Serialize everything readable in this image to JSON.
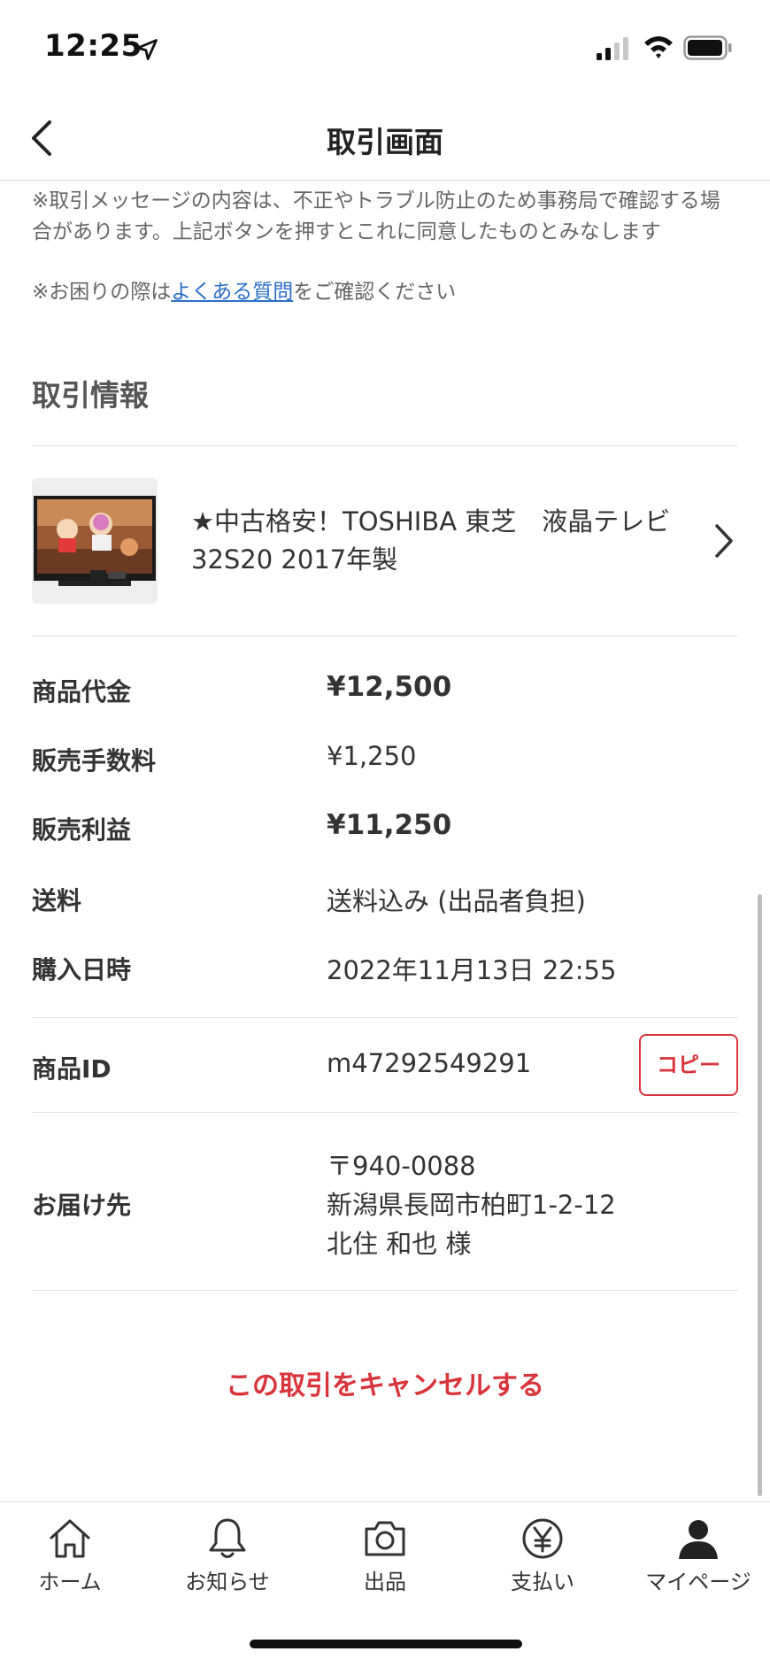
{
  "status_bar": {
    "time": "12:25"
  },
  "header": {
    "title": "取引画面"
  },
  "notices": {
    "line1": "※取引メッセージの内容は、不正やトラブル防止のため事務局で確認する場合があります。上記ボタンを押すとこれに同意したものとみなします",
    "line2_prefix": "※お困りの際は",
    "line2_link": "よくある質問",
    "line2_suffix": "をご確認ください"
  },
  "section_title": "取引情報",
  "product": {
    "name": "★中古格安！TOSHIBA 東芝　液晶テレビ 32S20 2017年製"
  },
  "details": {
    "price_label": "商品代金",
    "price_value": "¥12,500",
    "fee_label": "販売手数料",
    "fee_value": "¥1,250",
    "profit_label": "販売利益",
    "profit_value": "¥11,250",
    "shipping_label": "送料",
    "shipping_value": "送料込み (出品者負担)",
    "date_label": "購入日時",
    "date_value": "2022年11月13日 22:55",
    "id_label": "商品ID",
    "id_value": "m47292549291",
    "copy_label": "コピー",
    "address_label": "お届け先",
    "address_postal": "〒940-0088",
    "address_line": "新潟県長岡市柏町1-2-12",
    "address_name": "北住 和也 様"
  },
  "cancel_label": "この取引をキャンセルする",
  "tabs": [
    {
      "label": "ホーム",
      "icon": "home-icon"
    },
    {
      "label": "お知らせ",
      "icon": "bell-icon"
    },
    {
      "label": "出品",
      "icon": "camera-icon"
    },
    {
      "label": "支払い",
      "icon": "yen-icon"
    },
    {
      "label": "マイページ",
      "icon": "person-icon"
    }
  ],
  "colors": {
    "accent": "#d9343a",
    "link": "#2a6fc9"
  }
}
